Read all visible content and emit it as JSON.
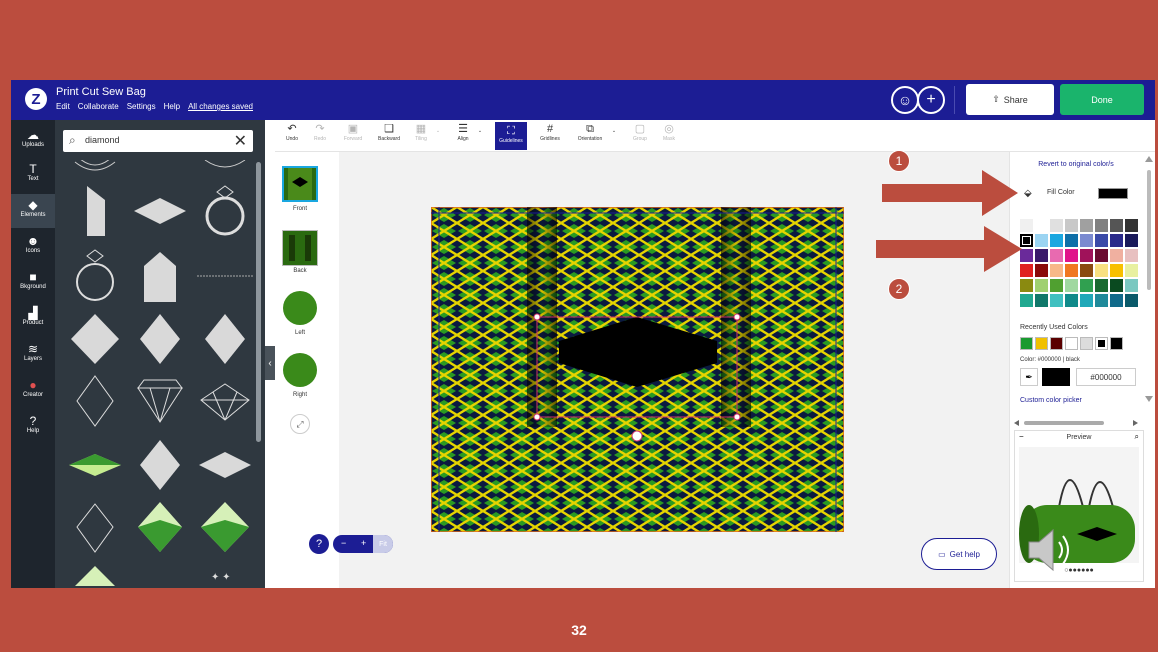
{
  "header": {
    "logo": "Z",
    "title": "Print Cut Sew Bag",
    "menu": [
      "Edit",
      "Collaborate",
      "Settings",
      "Help"
    ],
    "saved": "All changes saved",
    "share_label": "Share",
    "done_label": "Done",
    "colors": {
      "bar": "#1c1d94",
      "done": "#1ab46c"
    }
  },
  "left_nav": [
    {
      "label": "Uploads",
      "icon": "upload-cloud-icon"
    },
    {
      "label": "Text",
      "icon": "text-icon"
    },
    {
      "label": "Elements",
      "icon": "elements-icon",
      "active": true
    },
    {
      "label": "Icons",
      "icon": "smiley-icon"
    },
    {
      "label": "Bkground",
      "icon": "background-icon"
    },
    {
      "label": "Product",
      "icon": "product-icon"
    },
    {
      "label": "Layers",
      "icon": "layers-icon"
    },
    {
      "label": "Creator",
      "icon": "creator-icon"
    },
    {
      "label": "Help",
      "icon": "help-icon"
    }
  ],
  "search": {
    "value": "diamond"
  },
  "toolbar": [
    {
      "label": "Undo",
      "glyph": "↶",
      "disabled": false
    },
    {
      "label": "Redo",
      "glyph": "↷",
      "disabled": true
    },
    {
      "label": "Forward",
      "glyph": "▣",
      "disabled": true
    },
    {
      "label": "Backward",
      "glyph": "❑",
      "disabled": false
    },
    {
      "label": "Tiling",
      "glyph": "▦",
      "disabled": true
    },
    {
      "label": "Align",
      "glyph": "☰",
      "disabled": false
    },
    {
      "label": "Guidelines",
      "glyph": "⛶",
      "disabled": false,
      "active": true
    },
    {
      "label": "Gridlines",
      "glyph": "#",
      "disabled": false
    },
    {
      "label": "Orientation",
      "glyph": "⧉",
      "disabled": false
    },
    {
      "label": "Group",
      "glyph": "▢",
      "disabled": true
    },
    {
      "label": "Mask",
      "glyph": "◎",
      "disabled": true
    }
  ],
  "views": [
    "Front",
    "Back",
    "Left",
    "Right"
  ],
  "zoom": {
    "minus": "−",
    "plus": "+",
    "fit": "Fit"
  },
  "get_help": "Get help",
  "color_panel": {
    "revert": "Revert to original color/s",
    "fill_label": "Fill Color",
    "palette": [
      "#f0f0f0",
      "#ffffff",
      "#e0e0e0",
      "#c8c8c8",
      "#a0a0a0",
      "#808080",
      "#555555",
      "#333333",
      "#000000",
      "#9bd4f2",
      "#1aa7e0",
      "#0e6fa8",
      "#7a8ad0",
      "#3a4aa8",
      "#2a2a8a",
      "#1a1a5a",
      "#6a2a9a",
      "#3a1a6a",
      "#e86ab0",
      "#e0148a",
      "#a0125a",
      "#6a0a30",
      "#f0b0a0",
      "#e8c0c0",
      "#e02020",
      "#8a0a0a",
      "#f8b888",
      "#f07820",
      "#8a4a10",
      "#f8e080",
      "#f8c000",
      "#e8f0a0",
      "#8a8a10",
      "#a0d070",
      "#50a030",
      "#a0d8a0",
      "#30a050",
      "#1a6a30",
      "#0a4a20",
      "#7ac8c0",
      "#20a890",
      "#10786a",
      "#40c0c0",
      "#108a8a",
      "#20a8b8",
      "#208a9a",
      "#106a8a",
      "#0a5a6a"
    ],
    "selected_index": 8,
    "recent_label": "Recently Used Colors",
    "recent": [
      "#1a9a30",
      "#f0c000",
      "#5a0000",
      "#ffffff",
      "#dcdcdc",
      "#000000",
      "#000000"
    ],
    "color_info": "Color: #000000 | black",
    "hex": "#000000",
    "custom": "Custom color picker"
  },
  "preview": {
    "title": "Preview"
  },
  "callouts": [
    "1",
    "2"
  ],
  "page_number": "32"
}
